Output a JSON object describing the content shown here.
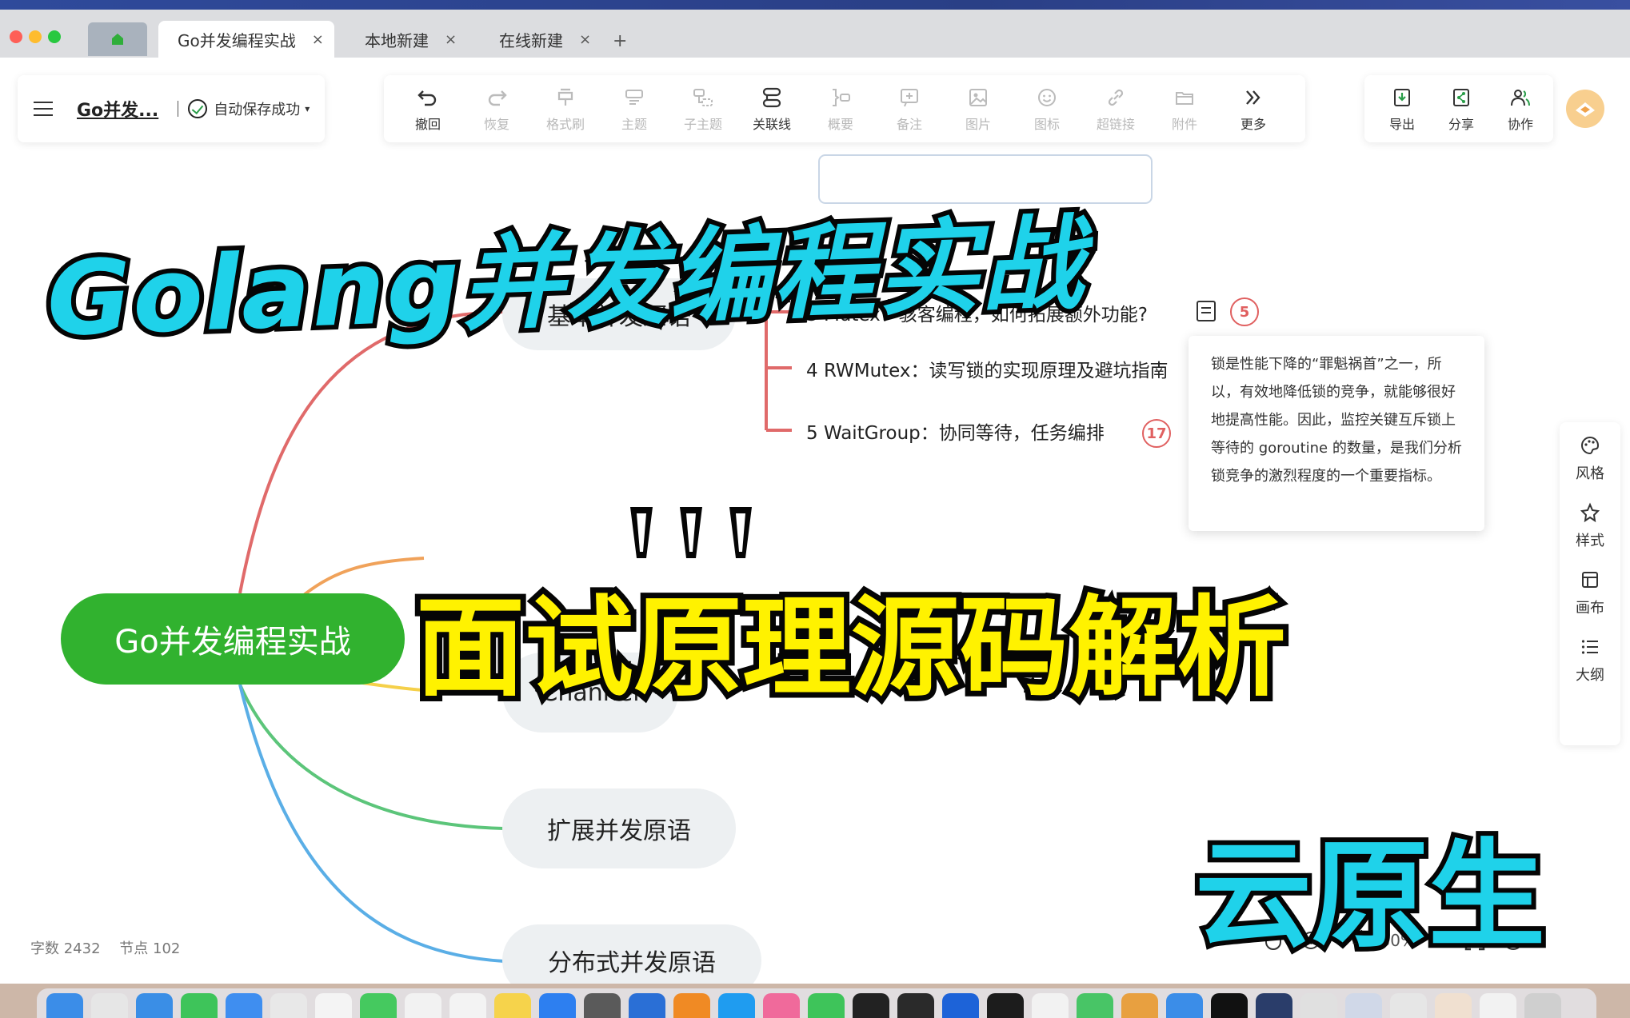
{
  "window": {
    "tabs": [
      {
        "label": "Go并发编程实战",
        "close": "×"
      },
      {
        "label": "本地新建",
        "close": "×"
      },
      {
        "label": "在线新建",
        "close": "×"
      }
    ],
    "new_tab": "+"
  },
  "doc": {
    "title": "Go并发...",
    "save_status": "自动保存成功",
    "save_caret": "▾"
  },
  "toolbar": [
    {
      "label": "撤回",
      "icon": "undo-icon",
      "enabled": true
    },
    {
      "label": "恢复",
      "icon": "redo-icon",
      "enabled": false
    },
    {
      "label": "格式刷",
      "icon": "format-brush-icon",
      "enabled": false
    },
    {
      "label": "主题",
      "icon": "topic-icon",
      "enabled": false
    },
    {
      "label": "子主题",
      "icon": "subtopic-icon",
      "enabled": false
    },
    {
      "label": "关联线",
      "icon": "relation-line-icon",
      "enabled": true
    },
    {
      "label": "概要",
      "icon": "summary-icon",
      "enabled": false
    },
    {
      "label": "备注",
      "icon": "note-add-icon",
      "enabled": false
    },
    {
      "label": "图片",
      "icon": "image-icon",
      "enabled": false
    },
    {
      "label": "图标",
      "icon": "emoji-icon",
      "enabled": false
    },
    {
      "label": "超链接",
      "icon": "link-icon",
      "enabled": false
    },
    {
      "label": "附件",
      "icon": "attachment-icon",
      "enabled": false
    },
    {
      "label": "更多",
      "icon": "chevrons-right-icon",
      "enabled": true
    }
  ],
  "right_actions": [
    {
      "label": "导出",
      "icon": "export-icon"
    },
    {
      "label": "分享",
      "icon": "share-icon"
    },
    {
      "label": "协作",
      "icon": "collaborate-icon"
    }
  ],
  "side_panel": [
    {
      "label": "风格",
      "icon": "palette-icon"
    },
    {
      "label": "样式",
      "icon": "style-icon"
    },
    {
      "label": "画布",
      "icon": "canvas-icon"
    },
    {
      "label": "大纲",
      "icon": "outline-icon"
    }
  ],
  "mindmap": {
    "root": "Go并发编程实战",
    "branches": [
      "基本并发原语",
      "Channel",
      "扩展并发原语",
      "分布式并发原语"
    ],
    "leaves": [
      {
        "text": "3 Mutex：骇客编程，如何拓展额外功能?",
        "badge": "5"
      },
      {
        "text": "4 RWMutex：读写锁的实现原理及避坑指南",
        "badge": ""
      },
      {
        "text": "5 WaitGroup：协同等待，任务编排",
        "badge": "17"
      }
    ],
    "note_tooltip": "锁是性能下降的“罪魁祸首”之一，所以，有效地降低锁的竞争，就能够很好地提高性能。因此，监控关键互斥锁上等待的 goroutine 的数量，是我们分析锁竞争的激烈程度的一个重要指标。"
  },
  "status": {
    "words_label": "字数",
    "words": "2432",
    "nodes_label": "节点",
    "nodes": "102"
  },
  "zoom": {
    "minus": "−",
    "level": "130%",
    "plus": "+"
  },
  "overlay": {
    "title": "Golang并发编程实战",
    "subtitle": "面试原理源码解析",
    "tag": "云原生"
  },
  "colors": {
    "root": "#31b22f",
    "branch1": "#e06a6a",
    "branch2": "#f0a25a",
    "branch3": "#f5d04a",
    "branch4": "#5cc57a",
    "branch5": "#5aaee6",
    "overlay_cyan": "#1fd2ea",
    "overlay_yellow": "#fff200"
  }
}
